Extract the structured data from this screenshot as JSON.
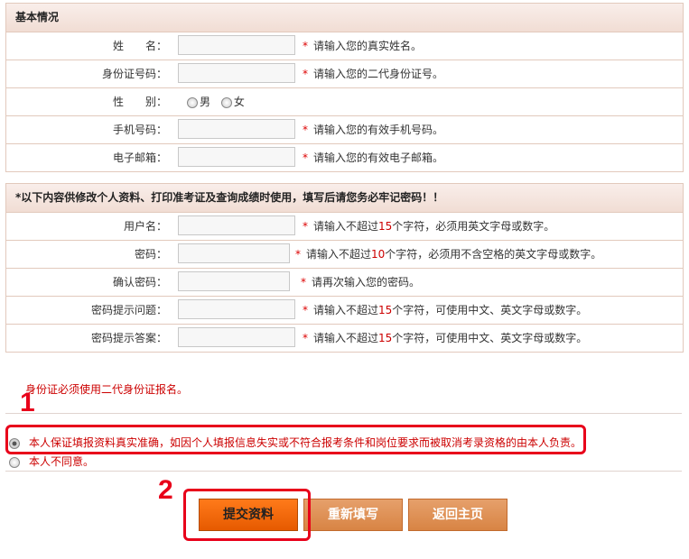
{
  "basic": {
    "title": "基本情况",
    "rows": [
      {
        "label": "姓　　名：",
        "hint": "请输入您的真实姓名。"
      },
      {
        "label": "身份证号码：",
        "hint": "请输入您的二代身份证号。"
      },
      {
        "label": "性　　别：",
        "male": "男",
        "female": "女"
      },
      {
        "label": "手机号码：",
        "hint": "请输入您的有效手机号码。"
      },
      {
        "label": "电子邮箱：",
        "hint": "请输入您的有效电子邮箱。"
      }
    ]
  },
  "account": {
    "title": "*以下内容供修改个人资料、打印准考证及查询成绩时使用，填写后请您务必牢记密码！！",
    "rows": [
      {
        "label": "用户名：",
        "hint_a": "请输入不超过",
        "num": "15",
        "hint_b": "个字符，必须用英文字母或数字。"
      },
      {
        "label": "密码：",
        "hint_a": "请输入不超过",
        "num": "10",
        "hint_b": "个字符，必须用不含空格的英文字母或数字。"
      },
      {
        "label": "确认密码：",
        "hint": "请再次输入您的密码。"
      },
      {
        "label": "密码提示问题：",
        "hint_a": "请输入不超过",
        "num": "15",
        "hint_b": "个字符，可使用中文、英文字母或数字。"
      },
      {
        "label": "密码提示答案：",
        "hint_a": "请输入不超过",
        "num": "15",
        "hint_b": "个字符，可使用中文、英文字母或数字。"
      }
    ]
  },
  "star": "*",
  "notice": "身份证必须使用二代身份证报名。",
  "agree": "本人保证填报资料真实准确，如因个人填报信息失实或不符合报考条件和岗位要求而被取消考录资格的由本人负责。",
  "disagree": "本人不同意。",
  "steps": {
    "one": "1",
    "two": "2"
  },
  "buttons": {
    "submit": "提交资料",
    "reset": "重新填写",
    "home": "返回主页"
  }
}
